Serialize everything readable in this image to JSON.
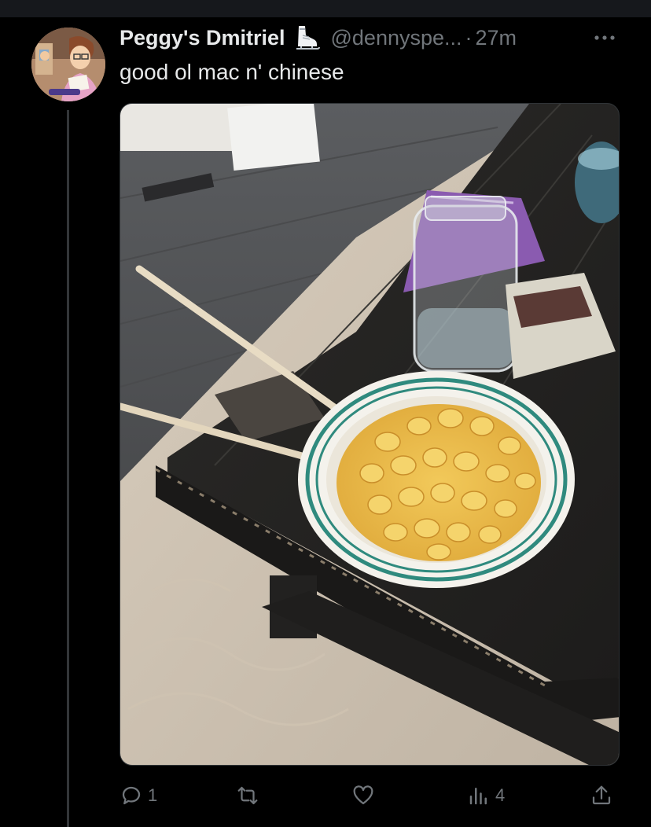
{
  "tweet": {
    "display_name": "Peggy's Dmitriel",
    "badge_icon": "ice-skate-icon",
    "handle": "@dennyspe...",
    "separator": "·",
    "time": "27m",
    "text": "good ol mac n' chinese",
    "avatar_alt": "cartoon character avatar",
    "media_alt": "bowl of macaroni shells on a dark wooden coffee table with chopsticks, a glass jar of water and snack bags"
  },
  "actions": {
    "reply_count": "1",
    "retweet_count": "",
    "like_count": "",
    "views_count": "4"
  },
  "icons": {
    "reply": "reply-icon",
    "retweet": "retweet-icon",
    "like": "heart-icon",
    "views": "views-icon",
    "share": "share-icon",
    "more": "more-icon"
  },
  "colors": {
    "background": "#000000",
    "text_primary": "#e7e9ea",
    "text_secondary": "#71767b",
    "divider": "#2f3336"
  }
}
